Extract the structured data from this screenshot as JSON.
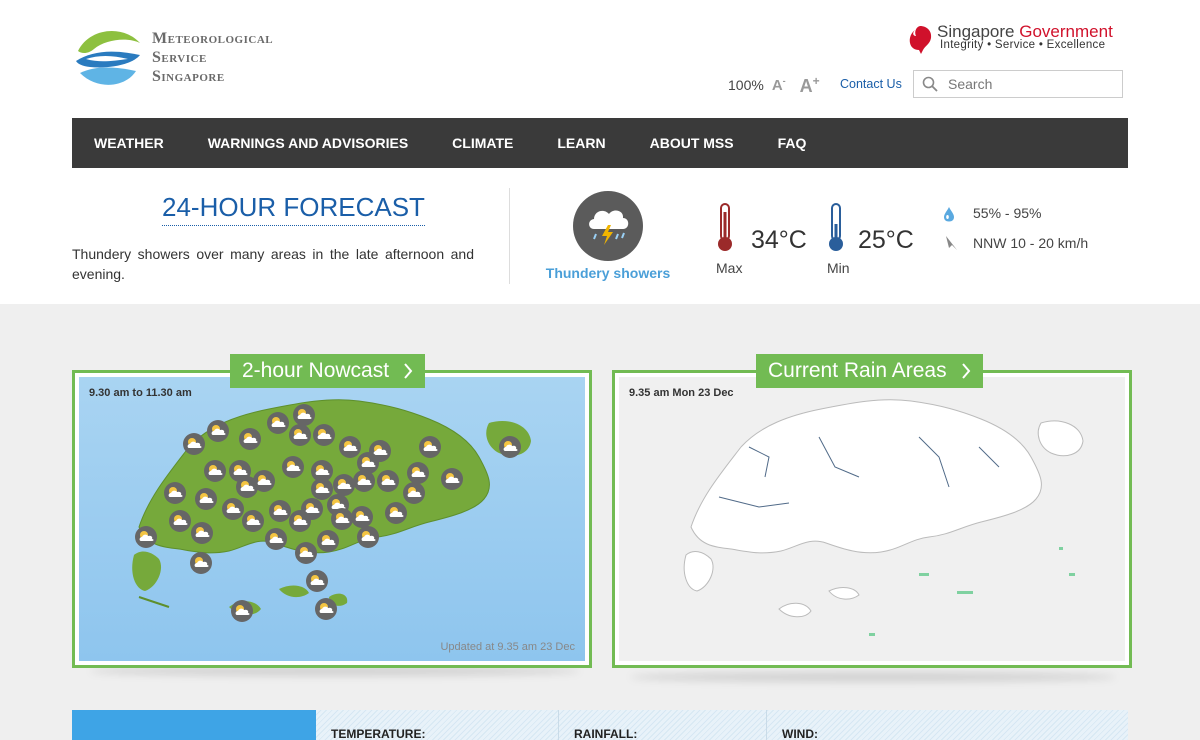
{
  "header": {
    "logo_lines": [
      "Meteorological",
      "Service",
      "Singapore"
    ],
    "gov_title_1": "Singapore",
    "gov_title_2": "Government",
    "gov_tagline": "Integrity • Service • Excellence",
    "zoom": "100%",
    "font_decrease": "A",
    "font_increase": "A",
    "contact": "Contact Us",
    "search_placeholder": "Search"
  },
  "nav": {
    "items": [
      {
        "label": "WEATHER"
      },
      {
        "label": "WARNINGS AND ADVISORIES"
      },
      {
        "label": "CLIMATE"
      },
      {
        "label": "LEARN"
      },
      {
        "label": "ABOUT MSS"
      },
      {
        "label": "FAQ"
      }
    ]
  },
  "forecast": {
    "title": "24-HOUR FORECAST",
    "description": "Thundery showers over many areas in the late afternoon and evening.",
    "condition": "Thundery showers",
    "max_temp": "34°C",
    "max_label": "Max",
    "min_temp": "25°C",
    "min_label": "Min",
    "humidity": "55% - 95%",
    "wind": "NNW 10 - 20 km/h"
  },
  "nowcast": {
    "title": "2-hour Nowcast",
    "period": "9.30 am to 11.30 am",
    "updated": "Updated at 9.35 am 23 Dec"
  },
  "rain": {
    "title": "Current Rain Areas",
    "timestamp": "9.35 am Mon 23 Dec"
  },
  "stats": {
    "temperature": "TEMPERATURE:",
    "rainfall": "RAINFALL:",
    "wind": "WIND:"
  },
  "colors": {
    "nav_bg": "#3a3a3a",
    "accent_green": "#72bb53",
    "link_blue": "#1a5ea8",
    "sky_blue": "#4a9fd8",
    "gov_red": "#d0112b"
  }
}
